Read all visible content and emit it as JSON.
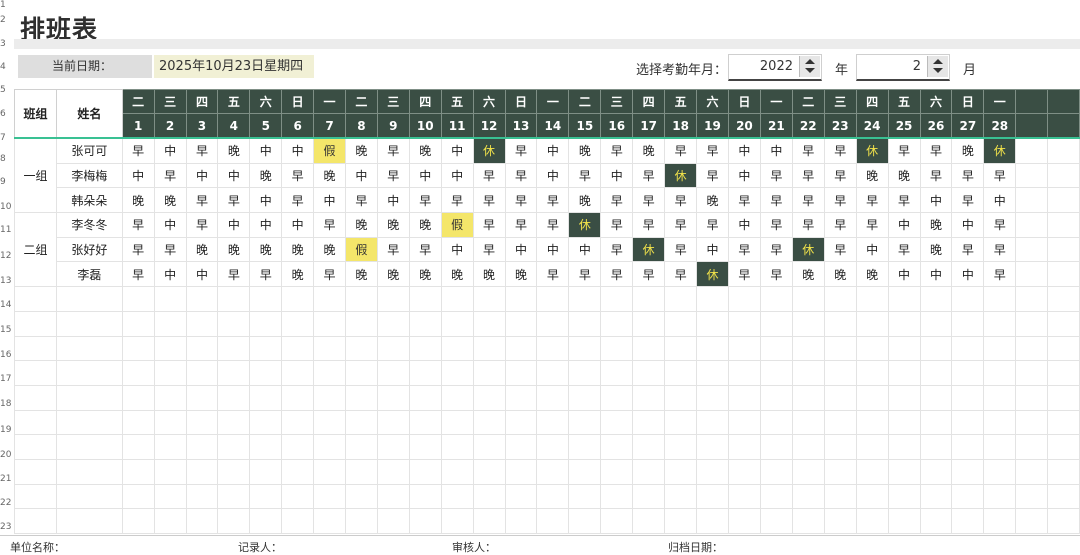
{
  "title": "排班表",
  "current_date_label": "当前日期：",
  "current_date_value": "2025年10月23日星期四",
  "select_label": "选择考勤年月：",
  "year_value": "2022",
  "year_unit": "年",
  "month_value": "2",
  "month_unit": "月",
  "headers": {
    "group": "班组",
    "name": "姓名"
  },
  "weekdays": [
    "二",
    "三",
    "四",
    "五",
    "六",
    "日",
    "一",
    "二",
    "三",
    "四",
    "五",
    "六",
    "日",
    "一",
    "二",
    "三",
    "四",
    "五",
    "六",
    "日",
    "一",
    "二",
    "三",
    "四",
    "五",
    "六",
    "日",
    "一"
  ],
  "days": [
    "1",
    "2",
    "3",
    "4",
    "5",
    "6",
    "7",
    "8",
    "9",
    "10",
    "11",
    "12",
    "13",
    "14",
    "15",
    "16",
    "17",
    "18",
    "19",
    "20",
    "21",
    "22",
    "23",
    "24",
    "25",
    "26",
    "27",
    "28"
  ],
  "row_numbers": [
    "1",
    "2",
    "3",
    "4",
    "5",
    "6",
    "7",
    "8",
    "9",
    "10",
    "11",
    "12",
    "13",
    "14",
    "15",
    "16",
    "17",
    "18",
    "19",
    "20",
    "21",
    "22",
    "23"
  ],
  "rows": [
    {
      "group": "一组",
      "name": "张可可",
      "shifts": [
        "早",
        "中",
        "早",
        "晚",
        "中",
        "中",
        "假",
        "晚",
        "早",
        "晚",
        "中",
        "休",
        "早",
        "中",
        "晚",
        "早",
        "晚",
        "早",
        "早",
        "中",
        "中",
        "早",
        "早",
        "休",
        "早",
        "早",
        "晚",
        "休"
      ]
    },
    {
      "group": "",
      "name": "李梅梅",
      "shifts": [
        "中",
        "早",
        "中",
        "中",
        "晚",
        "早",
        "晚",
        "中",
        "早",
        "中",
        "中",
        "早",
        "早",
        "中",
        "早",
        "中",
        "早",
        "休",
        "早",
        "中",
        "早",
        "早",
        "早",
        "晚",
        "晚",
        "早",
        "早",
        "早"
      ]
    },
    {
      "group": "",
      "name": "韩朵朵",
      "shifts": [
        "晚",
        "晚",
        "早",
        "早",
        "中",
        "早",
        "中",
        "早",
        "中",
        "早",
        "早",
        "早",
        "早",
        "早",
        "晚",
        "早",
        "早",
        "早",
        "晚",
        "早",
        "早",
        "早",
        "早",
        "早",
        "早",
        "中",
        "早",
        "中"
      ]
    },
    {
      "group": "二组",
      "name": "李冬冬",
      "shifts": [
        "早",
        "中",
        "早",
        "中",
        "中",
        "中",
        "早",
        "晚",
        "晚",
        "晚",
        "假",
        "早",
        "早",
        "早",
        "休",
        "早",
        "早",
        "早",
        "早",
        "中",
        "早",
        "早",
        "早",
        "早",
        "中",
        "晚",
        "中",
        "早"
      ]
    },
    {
      "group": "",
      "name": "张好好",
      "shifts": [
        "早",
        "早",
        "晚",
        "晚",
        "晚",
        "晚",
        "晚",
        "假",
        "早",
        "早",
        "中",
        "早",
        "中",
        "中",
        "中",
        "早",
        "休",
        "早",
        "中",
        "早",
        "早",
        "休",
        "早",
        "中",
        "早",
        "晚",
        "早",
        "早"
      ]
    },
    {
      "group": "",
      "name": "李磊",
      "shifts": [
        "早",
        "中",
        "中",
        "早",
        "早",
        "晚",
        "早",
        "晚",
        "晚",
        "晚",
        "晚",
        "晚",
        "晚",
        "早",
        "早",
        "早",
        "早",
        "早",
        "休",
        "早",
        "早",
        "晚",
        "晚",
        "晚",
        "中",
        "中",
        "中",
        "早"
      ]
    }
  ],
  "empty_rows": 10,
  "footer": {
    "unit_name": "单位名称：",
    "recorder": "记录人：",
    "reviewer": "审核人：",
    "archive_date": "归档日期："
  },
  "colors": {
    "header_bg": "#3a4e44",
    "rest_text": "#f1e24a",
    "leave_bg": "#f4e66a",
    "accent_line": "#39c193"
  }
}
